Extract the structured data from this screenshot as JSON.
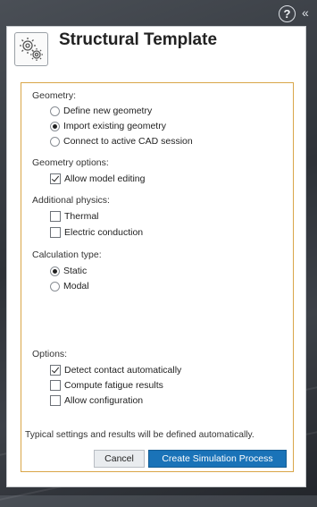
{
  "header": {
    "help_icon": "help-icon",
    "help_glyph": "?",
    "collapse_icon": "double-chevron-right-icon",
    "collapse_glyph": "«"
  },
  "panel": {
    "title": "Structural Template",
    "icon": "gears-icon"
  },
  "sections": {
    "geometry": {
      "label": "Geometry:",
      "options": [
        {
          "label": "Define new geometry",
          "selected": false
        },
        {
          "label": "Import existing geometry",
          "selected": true
        },
        {
          "label": "Connect to active CAD session",
          "selected": false
        }
      ]
    },
    "geometry_options": {
      "label": "Geometry options:",
      "options": [
        {
          "label": "Allow model editing",
          "checked": true
        }
      ]
    },
    "additional_physics": {
      "label": "Additional physics:",
      "options": [
        {
          "label": "Thermal",
          "checked": false
        },
        {
          "label": "Electric conduction",
          "checked": false
        }
      ]
    },
    "calculation_type": {
      "label": "Calculation type:",
      "options": [
        {
          "label": "Static",
          "selected": true
        },
        {
          "label": "Modal",
          "selected": false
        }
      ]
    },
    "options": {
      "label": "Options:",
      "options": [
        {
          "label": "Detect contact automatically",
          "checked": true
        },
        {
          "label": "Compute fatigue results",
          "checked": false
        },
        {
          "label": "Allow configuration",
          "checked": false
        }
      ]
    }
  },
  "footer": {
    "note": "Typical settings and results will be defined automatically.",
    "cancel_label": "Cancel",
    "create_label": "Create Simulation Process"
  },
  "colors": {
    "accent_blue": "#1a73b8",
    "group_border": "#d9a648"
  }
}
